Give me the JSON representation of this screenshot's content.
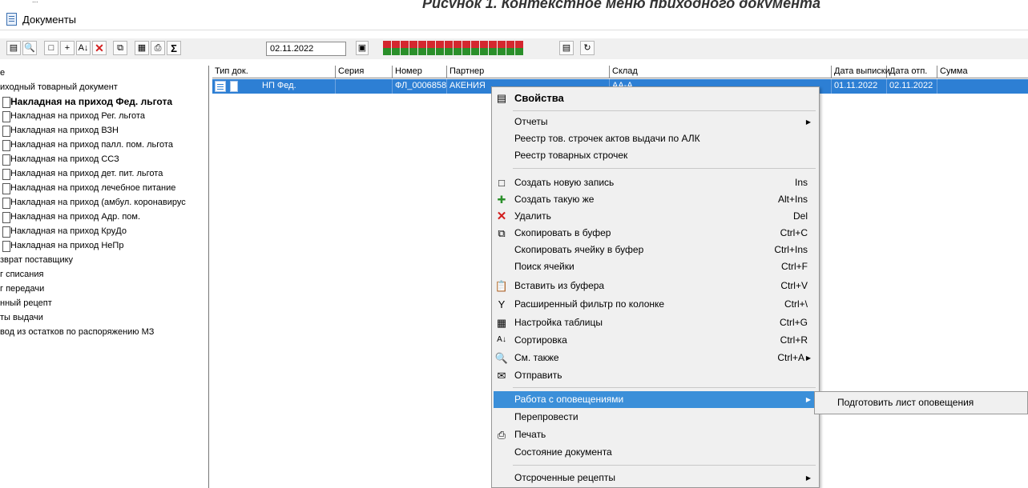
{
  "caption": {
    "small_text": "...",
    "figure_text": "Рисунок 1. Контекстное меню приходного документа"
  },
  "window": {
    "title": "Документы",
    "icon": "document-icon"
  },
  "toolbar": {
    "date_value": "02.11.2022",
    "sum_label": "Σ"
  },
  "tree": {
    "items": [
      {
        "label": "е",
        "type": "root"
      },
      {
        "label": "иходный товарный документ",
        "type": "root"
      },
      {
        "label": "Накладная на приход Фед. льгота",
        "type": "sub",
        "bold": true
      },
      {
        "label": "Накладная на приход Рег. льгота",
        "type": "sub"
      },
      {
        "label": "Накладная на приход ВЗН",
        "type": "sub"
      },
      {
        "label": "Накладная на приход палл. пом. льгота",
        "type": "sub"
      },
      {
        "label": "Накладная на приход ССЗ",
        "type": "sub"
      },
      {
        "label": "Накладная на приход дет. пит. льгота",
        "type": "sub"
      },
      {
        "label": "Накладная на приход лечебное питание",
        "type": "sub"
      },
      {
        "label": "Накладная на приход (амбул. коронавирус",
        "type": "sub"
      },
      {
        "label": "Накладная на приход Адр. пом.",
        "type": "sub"
      },
      {
        "label": "Накладная на приход КруДо",
        "type": "sub"
      },
      {
        "label": "Накладная на приход НеПр",
        "type": "sub"
      },
      {
        "label": "зврат поставщику",
        "type": "root"
      },
      {
        "label": "г списания",
        "type": "root"
      },
      {
        "label": "г передачи",
        "type": "root"
      },
      {
        "label": "нный рецепт",
        "type": "root"
      },
      {
        "label": "ты выдачи",
        "type": "root"
      },
      {
        "label": "вод из остатков по распоряжению МЗ",
        "type": "root"
      }
    ]
  },
  "grid": {
    "columns": [
      "Тип док.",
      "Серия",
      "Номер",
      "Партнер",
      "Склад",
      "Дата выписки",
      "Дата отп.",
      "Сумма"
    ],
    "row": {
      "type_text": "НП Фед.",
      "series": "",
      "number": "ФЛ_0006858",
      "partner": "АКЕНИЯ",
      "warehouse": "АА-А",
      "issue_date": "01.11.2022",
      "ship_date": "02.11.2022",
      "sum": ""
    }
  },
  "context_menu": {
    "properties": "Свойства",
    "reports": "Отчеты",
    "register_alk": "Реестр тов. строчек актов выдачи по АЛК",
    "register_lines": "Реестр товарных строчек",
    "create_new": "Создать новую запись",
    "create_new_sc": "Ins",
    "create_same": "Создать такую же",
    "create_same_sc": "Alt+Ins",
    "delete": "Удалить",
    "delete_sc": "Del",
    "copy": "Скопировать в буфер",
    "copy_sc": "Ctrl+C",
    "copy_cell": "Скопировать ячейку в буфер",
    "copy_cell_sc": "Ctrl+Ins",
    "find_cell": "Поиск ячейки",
    "find_cell_sc": "Ctrl+F",
    "paste": "Вставить из буфера",
    "paste_sc": "Ctrl+V",
    "filter": "Расширенный фильтр по колонке",
    "filter_sc": "Ctrl+\\",
    "table_settings": "Настройка таблицы",
    "table_settings_sc": "Ctrl+G",
    "sort": "Сортировка",
    "sort_sc": "Ctrl+R",
    "see_also": "См. также",
    "see_also_sc": "Ctrl+A",
    "send": "Отправить",
    "notifications": "Работа с оповещениями",
    "repost": "Перепровести",
    "print": "Печать",
    "doc_state": "Состояние документа",
    "deferred": "Отсроченные рецепты"
  },
  "submenu": {
    "prepare_notice": "Подготовить лист оповещения"
  },
  "colors": {
    "selection": "#2d7fd4",
    "menu_highlight": "#3b8fd9",
    "delete_red": "#d21e1e"
  }
}
